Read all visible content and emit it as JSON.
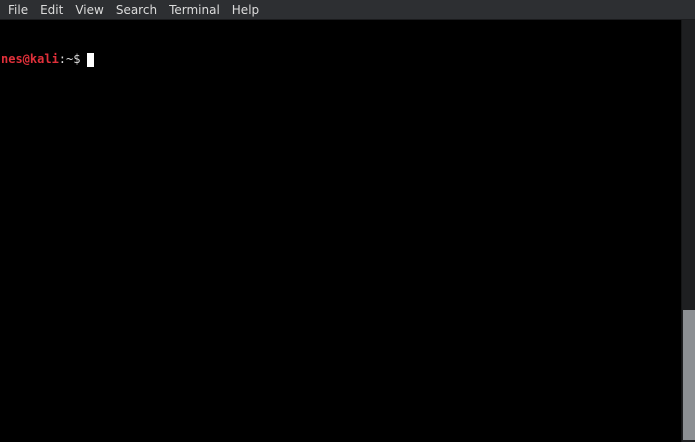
{
  "menubar": {
    "items": [
      {
        "label": "File"
      },
      {
        "label": "Edit"
      },
      {
        "label": "View"
      },
      {
        "label": "Search"
      },
      {
        "label": "Terminal"
      },
      {
        "label": "Help"
      }
    ]
  },
  "terminal": {
    "prompt": {
      "user_host": "nes@kali",
      "separator": ":",
      "path": "~",
      "symbol": "$"
    }
  },
  "colors": {
    "background": "#000000",
    "menubar": "#2d2f32",
    "prompt_user": "#e0303a",
    "text": "#dcdcdc"
  },
  "scrollbar": {
    "scroll_position": 1.0
  }
}
